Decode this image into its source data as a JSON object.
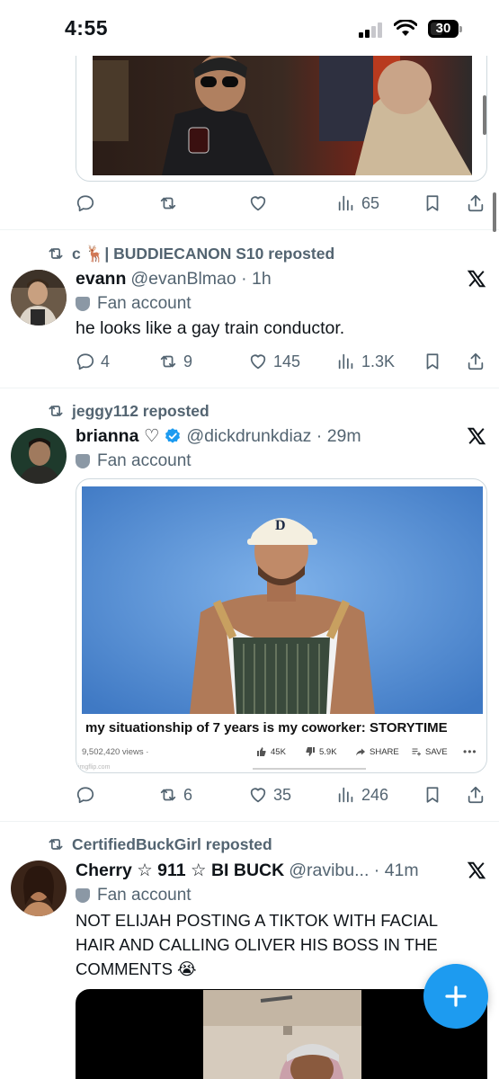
{
  "status_bar": {
    "time": "4:55",
    "battery": "30"
  },
  "tweets": [
    {
      "media_description": "",
      "actions": {
        "reply": "",
        "repost": "",
        "like": "",
        "views": "65"
      }
    },
    {
      "repost_by": "c 🦌| BUDDIECANON S10 reposted",
      "name": "evann",
      "handle": "@evanBlmao · 1h",
      "fan_label": "Fan account",
      "text": "he looks like a gay train conductor.",
      "actions": {
        "reply": "4",
        "repost": "9",
        "like": "145",
        "views": "1.3K"
      }
    },
    {
      "repost_by": "jeggy112 reposted",
      "name": "brianna ♡",
      "handle": "@dickdrunkdiaz · 29m",
      "fan_label": "Fan account",
      "video": {
        "title": "my situationship of 7 years is my coworker: STORYTIME",
        "views": "9,502,420 views ·",
        "likes": "45K",
        "dislikes": "5.9K",
        "share": "SHARE",
        "save": "SAVE",
        "watermark": "imgflip.com"
      },
      "actions": {
        "reply": "",
        "repost": "6",
        "like": "35",
        "views": "246"
      }
    },
    {
      "repost_by": "CertifiedBuckGirl reposted",
      "name": "Cherry ☆ 911 ☆ BI BUCK",
      "handle": "@ravibu... · 41m",
      "fan_label": "Fan account",
      "text": "NOT ELIJAH POSTING A TIKTOK WITH FACIAL HAIR AND CALLING OLIVER HIS BOSS IN THE COMMENTS 😭"
    }
  ],
  "colors": {
    "accent": "#1d9bf0",
    "secondary_text": "#536471",
    "verified": "#1d9bf0"
  }
}
